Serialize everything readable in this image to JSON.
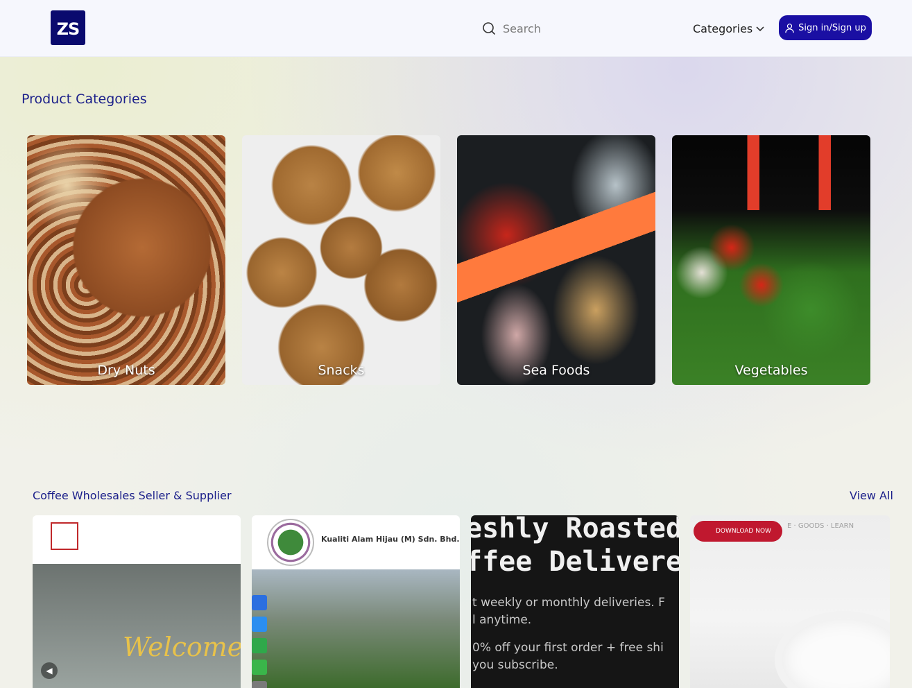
{
  "header": {
    "logo_text": "ZS",
    "search_placeholder": "Search",
    "categories_label": "Categories",
    "signin_label": "Sign in/Sign up"
  },
  "product_categories": {
    "title": "Product Categories",
    "items": [
      {
        "label": "Dry Nuts"
      },
      {
        "label": "Snacks"
      },
      {
        "label": "Sea Foods"
      },
      {
        "label": "Vegetables"
      }
    ]
  },
  "coffee_section": {
    "title": "Coffee Wholesales Seller & Supplier",
    "view_all": "View All",
    "cards": [
      {
        "overlay_text": "Welcome!"
      },
      {
        "company_name": "Kualiti Alam Hijau (M) Sdn. Bhd."
      },
      {
        "headline_1": "eshly Roasted",
        "headline_2": "ffee Delivered",
        "line_1": "t weekly or monthly deliveries. F",
        "line_2": "l anytime.",
        "line_3": "0% off your first order + free shi",
        "line_4": "you subscribe."
      },
      {
        "button": "DOWNLOAD NOW",
        "nav": "E · GOODS · LEARN"
      }
    ]
  },
  "colors": {
    "brand_dark": "#0a0a6e",
    "signin_bg": "#1a0fa3",
    "title_blue": "#1b1f8a"
  }
}
